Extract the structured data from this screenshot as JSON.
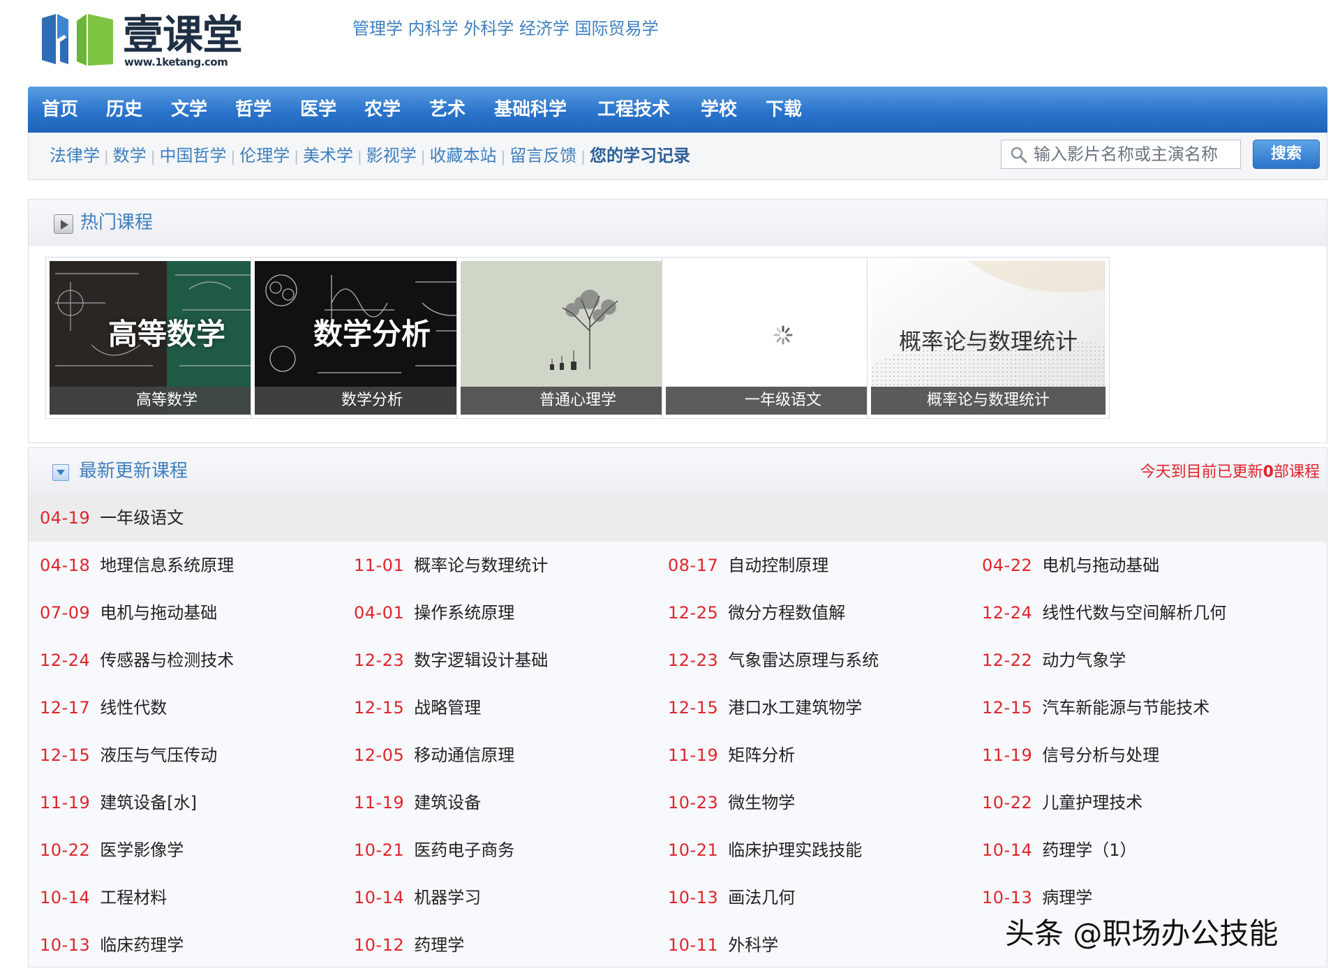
{
  "brand": {
    "title": "壹课堂",
    "url": "www.1ketang.com"
  },
  "top_links": "管理学 内科学 外科学 经济学 国际贸易学",
  "nav": [
    "首页",
    "历史",
    "文学",
    "哲学",
    "医学",
    "农学",
    "艺术",
    "基础科学",
    "工程技术",
    "学校",
    "下载"
  ],
  "sub_links": [
    "法律学",
    "数学",
    "中国哲学",
    "伦理学",
    "美术学",
    "影视学",
    "收藏本站",
    "留言反馈",
    "您的学习记录"
  ],
  "search": {
    "placeholder": "输入影片名称或主演名称",
    "button": "搜索"
  },
  "hot": {
    "title": "热门课程",
    "courses": [
      {
        "caption": "高等数学",
        "overlay": "高等数学"
      },
      {
        "caption": "数学分析",
        "overlay": "数学分析"
      },
      {
        "caption": "普通心理学",
        "overlay": ""
      },
      {
        "caption": "一年级语文",
        "overlay": ""
      },
      {
        "caption": "概率论与数理统计",
        "overlay": "概率论与数理统计"
      }
    ]
  },
  "latest": {
    "title": "最新更新课程",
    "today_prefix": "今天到目前已更新",
    "today_count": "0",
    "today_suffix": "部课程",
    "first": {
      "date": "04-19",
      "name": "一年级语文"
    },
    "rows": [
      [
        {
          "date": "04-18",
          "name": "地理信息系统原理"
        },
        {
          "date": "11-01",
          "name": "概率论与数理统计"
        },
        {
          "date": "08-17",
          "name": "自动控制原理"
        },
        {
          "date": "04-22",
          "name": "电机与拖动基础"
        }
      ],
      [
        {
          "date": "07-09",
          "name": "电机与拖动基础"
        },
        {
          "date": "04-01",
          "name": "操作系统原理"
        },
        {
          "date": "12-25",
          "name": "微分方程数值解"
        },
        {
          "date": "12-24",
          "name": "线性代数与空间解析几何"
        }
      ],
      [
        {
          "date": "12-24",
          "name": "传感器与检测技术"
        },
        {
          "date": "12-23",
          "name": "数字逻辑设计基础"
        },
        {
          "date": "12-23",
          "name": "气象雷达原理与系统"
        },
        {
          "date": "12-22",
          "name": "动力气象学"
        }
      ],
      [
        {
          "date": "12-17",
          "name": "线性代数"
        },
        {
          "date": "12-15",
          "name": "战略管理"
        },
        {
          "date": "12-15",
          "name": "港口水工建筑物学"
        },
        {
          "date": "12-15",
          "name": "汽车新能源与节能技术"
        }
      ],
      [
        {
          "date": "12-15",
          "name": "液压与气压传动"
        },
        {
          "date": "12-05",
          "name": "移动通信原理"
        },
        {
          "date": "11-19",
          "name": "矩阵分析"
        },
        {
          "date": "11-19",
          "name": "信号分析与处理"
        }
      ],
      [
        {
          "date": "11-19",
          "name": "建筑设备[水]"
        },
        {
          "date": "11-19",
          "name": "建筑设备"
        },
        {
          "date": "10-23",
          "name": "微生物学"
        },
        {
          "date": "10-22",
          "name": "儿童护理技术"
        }
      ],
      [
        {
          "date": "10-22",
          "name": "医学影像学"
        },
        {
          "date": "10-21",
          "name": "医药电子商务"
        },
        {
          "date": "10-21",
          "name": "临床护理实践技能"
        },
        {
          "date": "10-14",
          "name": "药理学（1）"
        }
      ],
      [
        {
          "date": "10-14",
          "name": "工程材料"
        },
        {
          "date": "10-14",
          "name": "机器学习"
        },
        {
          "date": "10-13",
          "name": "画法几何"
        },
        {
          "date": "10-13",
          "name": "病理学"
        }
      ],
      [
        {
          "date": "10-13",
          "name": "临床药理学"
        },
        {
          "date": "10-12",
          "name": "药理学"
        },
        {
          "date": "10-11",
          "name": "外科学"
        }
      ]
    ]
  },
  "watermark": "头条 @职场办公技能",
  "colors": {
    "accent_blue": "#3d7fbf",
    "nav_blue": "#2a74cc",
    "date_red": "#e0242b"
  }
}
